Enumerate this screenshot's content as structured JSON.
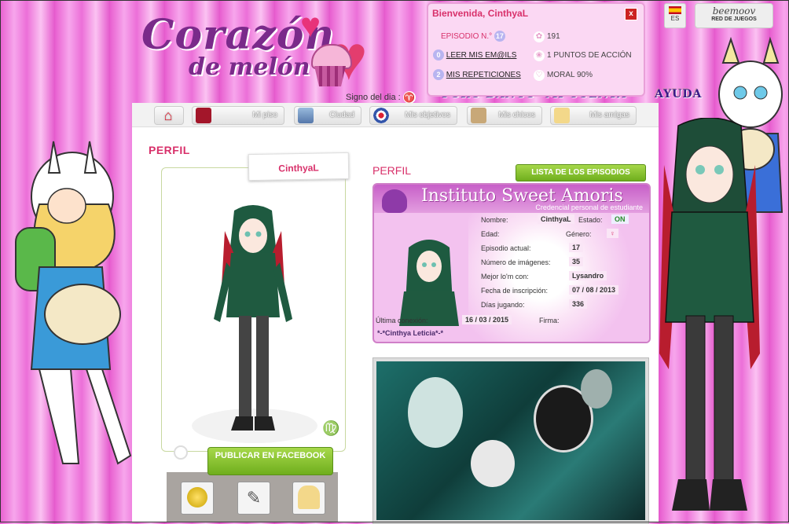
{
  "logo": {
    "title": "Corazón",
    "subtitle": "de melón"
  },
  "sign_of_day": {
    "label": "Signo del dia :",
    "symbol": "♈"
  },
  "forum_links": [
    "FORO",
    "BANCO",
    "MI CUENTA",
    "AYUDA"
  ],
  "welcome": {
    "title": "Bienvenida, CinthyaL",
    "close": "x",
    "episode_label": "EPISODIO N.°",
    "episode_num": "17",
    "coins": "191",
    "emails_count": "0",
    "emails_link": "LEER MIS EM@ILS",
    "action_points": "1 PUNTOS DE ACCIÓN",
    "repeats_count": "2",
    "repeats_link": "MIS REPETICIONES",
    "moral": "MORAL 90%"
  },
  "lang": {
    "code": "ES"
  },
  "partner": {
    "name": "beemoov",
    "tagline": "RED DE JUEGOS"
  },
  "nav": [
    {
      "label": ""
    },
    {
      "label": "Mi piso"
    },
    {
      "label": "Ciudad"
    },
    {
      "label": "Mis objetivos"
    },
    {
      "label": "Mis chicos"
    },
    {
      "label": "Mis amigas"
    }
  ],
  "profile": {
    "heading": "PERFIL",
    "username": "CinthyaL",
    "zodiac": "♍",
    "publish_button": "PUBLICAR EN FACEBOOK"
  },
  "credential": {
    "heading": "PERFIL",
    "episodes_button": "LISTA DE LOS EPISODIOS",
    "title": "Instituto Sweet Amoris",
    "subtitle": "Credencial personal de estudiante",
    "fields": {
      "nombre_label": "Nombre:",
      "nombre": "CinthyaL",
      "estado_label": "Estado:",
      "estado": "ON",
      "edad_label": "Edad:",
      "genero_label": "Género:",
      "genero": "♀",
      "episodio_label": "Episodio actual:",
      "episodio": "17",
      "imagenes_label": "Número de imágenes:",
      "imagenes": "35",
      "mejor_label": "Mejor lo'm con:",
      "mejor": "Lysandro",
      "inscripcion_label": "Fecha de inscripción:",
      "inscripcion": "07 / 08 / 2013",
      "dias_label": "Días jugando:",
      "dias": "336",
      "conexion_label": "Última conexión:",
      "conexion": "16 / 03 / 2015",
      "firma_label": "Firma:"
    },
    "motto": "*-*Cinthya Leticia*-*"
  }
}
